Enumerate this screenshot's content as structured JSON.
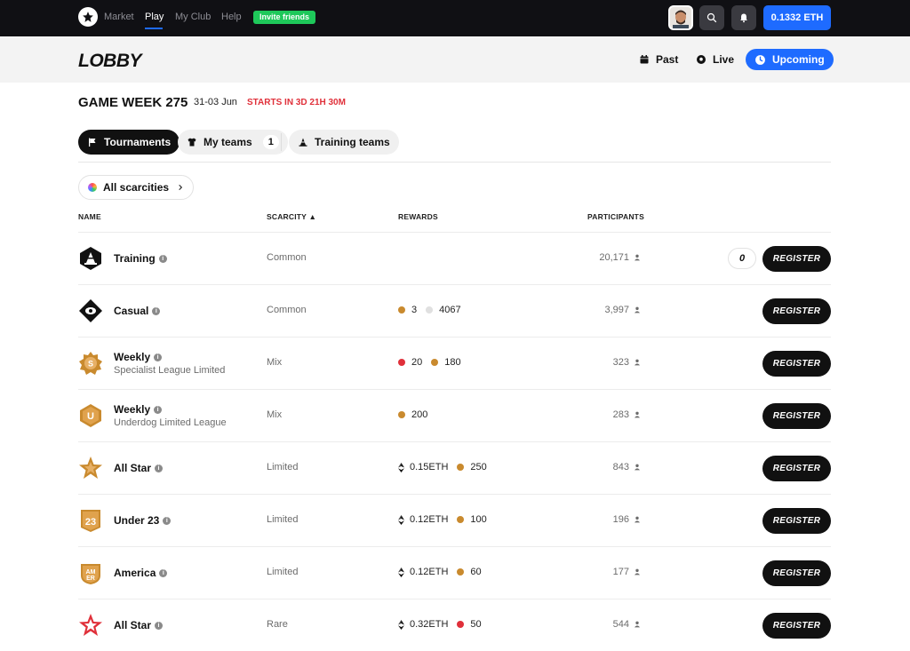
{
  "nav": {
    "links": [
      "Market",
      "Play",
      "My Club",
      "Help"
    ],
    "invite_label": "Invite friends",
    "balance": "0.1332 ETH"
  },
  "lobby": {
    "title": "LOBBY",
    "segments": [
      "Past",
      "Live",
      "Upcoming"
    ]
  },
  "game_week": {
    "title": "GAME WEEK 275",
    "dates": "31-03 Jun",
    "starts": "STARTS IN 3D 21H 30M"
  },
  "tabs": {
    "tournaments": "Tournaments",
    "my_teams": "My teams",
    "my_teams_count": "1",
    "training_teams": "Training teams"
  },
  "filter": {
    "scarcity_label": "All scarcities"
  },
  "table": {
    "headers": {
      "name": "NAME",
      "scarcity": "SCARCITY ▲",
      "rewards": "REWARDS",
      "participants": "PARTICIPANTS"
    },
    "register_label": "REGISTER",
    "rows": [
      {
        "name": "Training",
        "sub": "",
        "scarcity": "Common",
        "r1": "",
        "r2": "",
        "participants": "20,171",
        "count": "0"
      },
      {
        "name": "Casual",
        "sub": "",
        "scarcity": "Common",
        "r1": "3",
        "r2": "4067",
        "participants": "3,997"
      },
      {
        "name": "Weekly",
        "sub": "Specialist League Limited",
        "scarcity": "Mix",
        "r1": "20",
        "r2": "180",
        "participants": "323"
      },
      {
        "name": "Weekly",
        "sub": "Underdog Limited League",
        "scarcity": "Mix",
        "r1": "200",
        "r2": "",
        "participants": "283"
      },
      {
        "name": "All Star",
        "sub": "",
        "scarcity": "Limited",
        "r1": "0.15ETH",
        "r2": "250",
        "participants": "843"
      },
      {
        "name": "Under 23",
        "sub": "",
        "scarcity": "Limited",
        "r1": "0.12ETH",
        "r2": "100",
        "participants": "196"
      },
      {
        "name": "America",
        "sub": "",
        "scarcity": "Limited",
        "r1": "0.12ETH",
        "r2": "60",
        "participants": "177"
      },
      {
        "name": "All Star",
        "sub": "",
        "scarcity": "Rare",
        "r1": "0.32ETH",
        "r2": "50",
        "participants": "544"
      }
    ]
  },
  "badges": {
    "under23_text": "23",
    "america_text": "AM ER",
    "specialist_letter": "S",
    "underdog_letter": "U"
  },
  "colors": {
    "accent_blue": "#1e6bff",
    "invite_green": "#1ec85a",
    "limited_gold": "#c98a2e",
    "rare_red": "#e0303a"
  }
}
